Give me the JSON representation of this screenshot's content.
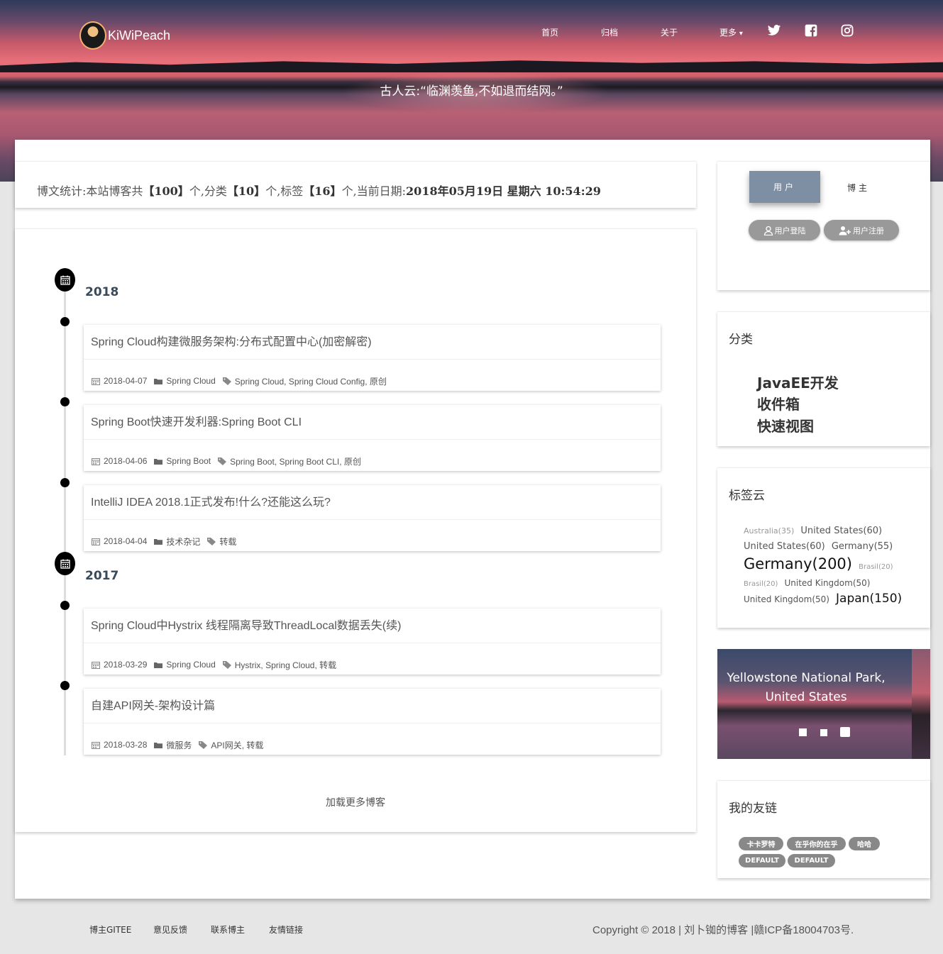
{
  "brand": {
    "name": "KiWiPeach"
  },
  "nav": {
    "items": [
      "首页",
      "归档",
      "关于",
      "更多"
    ],
    "more_caret": "▾"
  },
  "hero": {
    "quote": "古人云:“临渊羡鱼,不如退而结网。”"
  },
  "stats": {
    "prefix": "博文统计:本站博客共",
    "posts": "【100】",
    "mid1": "个,分类",
    "categories": "【10】",
    "mid2": "个,标签",
    "tags": "【16】",
    "mid3": "个,当前日期:",
    "datetime": "2018年05月19日 星期六 10:54:29"
  },
  "timeline": {
    "years": [
      "2018",
      "2017"
    ],
    "posts": [
      {
        "title": "Spring Cloud构建微服务架构:分布式配置中心(加密解密)",
        "date": "2018-04-07",
        "category": "Spring Cloud",
        "tags": "Spring Cloud, Spring Cloud Config, 原创"
      },
      {
        "title": "Spring Boot快速开发利器:Spring Boot CLI",
        "date": "2018-04-06",
        "category": "Spring Boot",
        "tags": "Spring Boot, Spring Boot CLI, 原创"
      },
      {
        "title": "IntelliJ IDEA 2018.1正式发布!什么?还能这么玩?",
        "date": "2018-04-04",
        "category": "技术杂记",
        "tags": "转载"
      },
      {
        "title": "Spring Cloud中Hystrix 线程隔离导致ThreadLocal数据丢失(续)",
        "date": "2018-03-29",
        "category": "Spring Cloud",
        "tags": "Hystrix, Spring Cloud, 转载"
      },
      {
        "title": "自建API网关-架构设计篇",
        "date": "2018-03-28",
        "category": "微服务",
        "tags": "API网关, 转载"
      }
    ],
    "load_more": "加载更多博客"
  },
  "sidebar": {
    "tabs": {
      "user": "用户",
      "boss": "博主"
    },
    "buttons": {
      "login": "用户登陆",
      "register": "用户注册"
    },
    "categories": {
      "title": "分类",
      "items": [
        "JavaEE开发",
        "收件箱",
        "快速视图"
      ]
    },
    "tagcloud": {
      "title": "标签云",
      "tags": [
        {
          "label": "Australia(35)",
          "size": 11
        },
        {
          "label": "United States(60)",
          "size": 13
        },
        {
          "label": "United States(60)",
          "size": 13
        },
        {
          "label": "Germany(55)",
          "size": 13
        },
        {
          "label": "Germany(200)",
          "size": 21
        },
        {
          "label": "Brasil(20)",
          "size": 10
        },
        {
          "label": "Brasil(20)",
          "size": 10
        },
        {
          "label": "United Kingdom(50)",
          "size": 12
        },
        {
          "label": "United Kingdom(50)",
          "size": 12
        },
        {
          "label": "Japan(150)",
          "size": 17
        }
      ]
    },
    "carousel": {
      "caption": "Yellowstone National Park, United States",
      "slides": 3
    },
    "friends": {
      "title": "我的友链",
      "links": [
        "卡卡罗特",
        "在乎你的在乎",
        "哈哈",
        "DEFAULT",
        "DEFAULT"
      ]
    }
  },
  "footer": {
    "links": [
      "博主GITEE",
      "意见反馈",
      "联系博主",
      "友情链接"
    ],
    "copyright": "Copyright © 2018 | 刘卜铷的博客 |赣ICP备18004703号."
  }
}
